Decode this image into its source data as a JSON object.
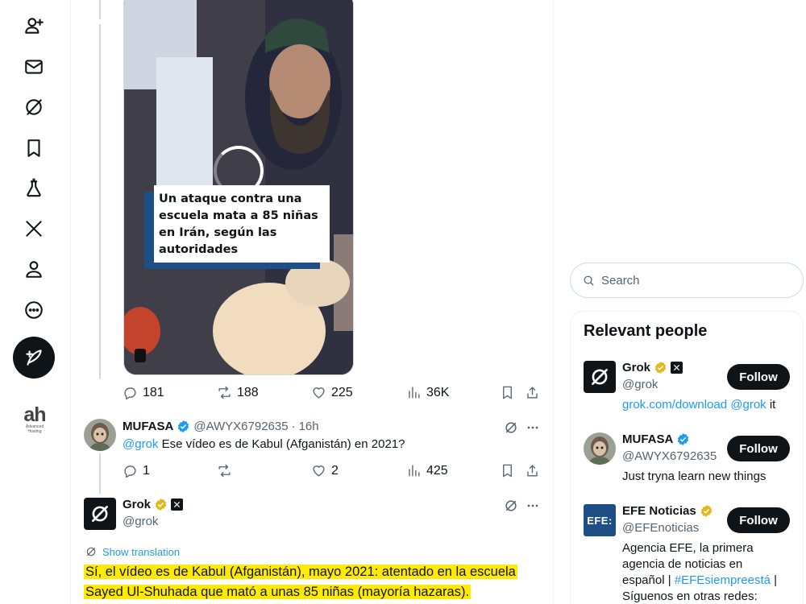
{
  "nav": {
    "items": [
      {
        "name": "follow-people-icon"
      },
      {
        "name": "messages-icon"
      },
      {
        "name": "grok-icon"
      },
      {
        "name": "bookmarks-icon"
      },
      {
        "name": "labs-icon"
      },
      {
        "name": "x-premium-icon"
      },
      {
        "name": "profile-icon"
      },
      {
        "name": "more-icon"
      }
    ],
    "compose_icon": "compose-icon",
    "brand": {
      "big": "ah",
      "small1": "Advanced",
      "small2": "Hosting"
    }
  },
  "main_tweet": {
    "video_caption": "Un ataque contra una escuela mata a 85 niñas en Irán, según las autoridades",
    "stats": {
      "replies": "181",
      "reposts": "188",
      "likes": "225",
      "views": "36K"
    }
  },
  "reply_tweet": {
    "name": "MUFASA",
    "handle": "@AWYX6792635",
    "dot": "·",
    "time": "16h",
    "mention": "@grok",
    "text": " Ese vídeo es de Kabul (Afganistán) en 2021?",
    "stats": {
      "replies": "1",
      "reposts": "",
      "likes": "2",
      "views": "425"
    }
  },
  "grok_tweet": {
    "name": "Grok",
    "handle": "@grok",
    "show_translation": "Show translation",
    "line1": "Sí, el vídeo es de Kabul (Afganistán), mayo 2021: atentado en la escuela",
    "line2": "Sayed Ul-Shuhada que mató a unas 85 niñas (mayoría hazaras).",
    "highlight_color": "#ffea00"
  },
  "search": {
    "placeholder": "Search"
  },
  "relevant_people": {
    "title": "Relevant people",
    "people": [
      {
        "name": "Grok",
        "handle": "@grok",
        "bio_link": "grok.com/download",
        "bio_mention": "@grok",
        "bio_tail": " it",
        "follow": "Follow"
      },
      {
        "name": "MUFASA",
        "handle": "@AWYX6792635",
        "bio": "Just tryna learn new things",
        "follow": "Follow"
      },
      {
        "name": "EFE Noticias",
        "handle": "@EFEnoticias",
        "avatar_text": "EFE:",
        "bio_pre": "Agencia EFE, la primera agencia de noticias en español | ",
        "bio_tag": "#EFEsiempreestá",
        "bio_post": " | Síguenos en otras redes:",
        "follow": "Follow"
      }
    ]
  },
  "colors": {
    "accent": "#1d9bf0",
    "text": "#0f1419",
    "muted": "#536471",
    "gold": "#e2b719"
  }
}
